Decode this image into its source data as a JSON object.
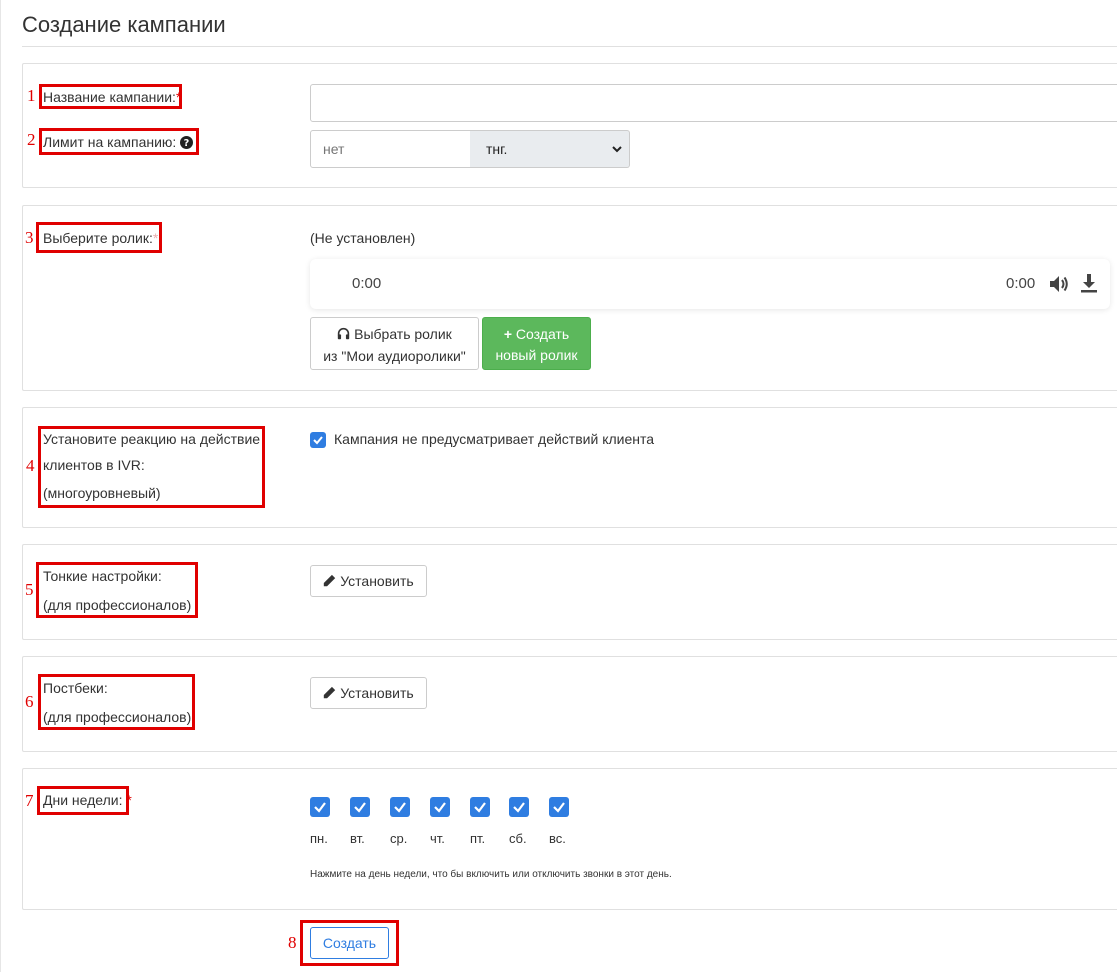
{
  "page": {
    "title": "Создание кампании"
  },
  "fields": {
    "campaign_name": {
      "label": "Название кампании:",
      "required_mark": "*",
      "value": "",
      "number": "1"
    },
    "limit": {
      "label": "Лимит на кампанию:",
      "placeholder": "нет",
      "currency": "тнг.",
      "number": "2",
      "help_icon": "question-circle-icon"
    },
    "clip": {
      "label": "Выберите ролик:",
      "required_mark": "*",
      "number": "3",
      "status": "(Не установлен)",
      "player": {
        "current_time": "0:00",
        "duration": "0:00"
      },
      "choose_button": {
        "line1": "Выбрать ролик",
        "line2": "из \"Мои аудиоролики\"",
        "icon": "headphones-icon"
      },
      "create_button": {
        "line1": "Создать",
        "line2": "новый ролик",
        "icon": "plus-icon"
      }
    },
    "ivr": {
      "label_line1": "Установите реакцию на действие",
      "label_line2": "клиентов в IVR:",
      "label_line3": "(многоуровневый)",
      "number": "4",
      "checkbox_label": "Кампания не предусматривает действий клиента",
      "checked": true
    },
    "fine_settings": {
      "label_line1": "Тонкие настройки:",
      "label_line2": "(для профессионалов)",
      "number": "5",
      "button": "Установить"
    },
    "postbacks": {
      "label_line1": "Постбеки:",
      "label_line2": "(для профессионалов)",
      "number": "6",
      "button": "Установить"
    },
    "weekdays": {
      "label": "Дни недели:",
      "required_mark": "*",
      "number": "7",
      "days": [
        "пн.",
        "вт.",
        "ср.",
        "чт.",
        "пт.",
        "сб.",
        "вс."
      ],
      "checked": [
        true,
        true,
        true,
        true,
        true,
        true,
        true
      ],
      "hint": "Нажмите на день недели, что бы включить или отключить звонки в этот день."
    }
  },
  "submit": {
    "label": "Создать",
    "number": "8"
  },
  "colors": {
    "annotation_red": "#e00000",
    "accent_blue": "#2f7de1",
    "green": "#5cb85c"
  }
}
